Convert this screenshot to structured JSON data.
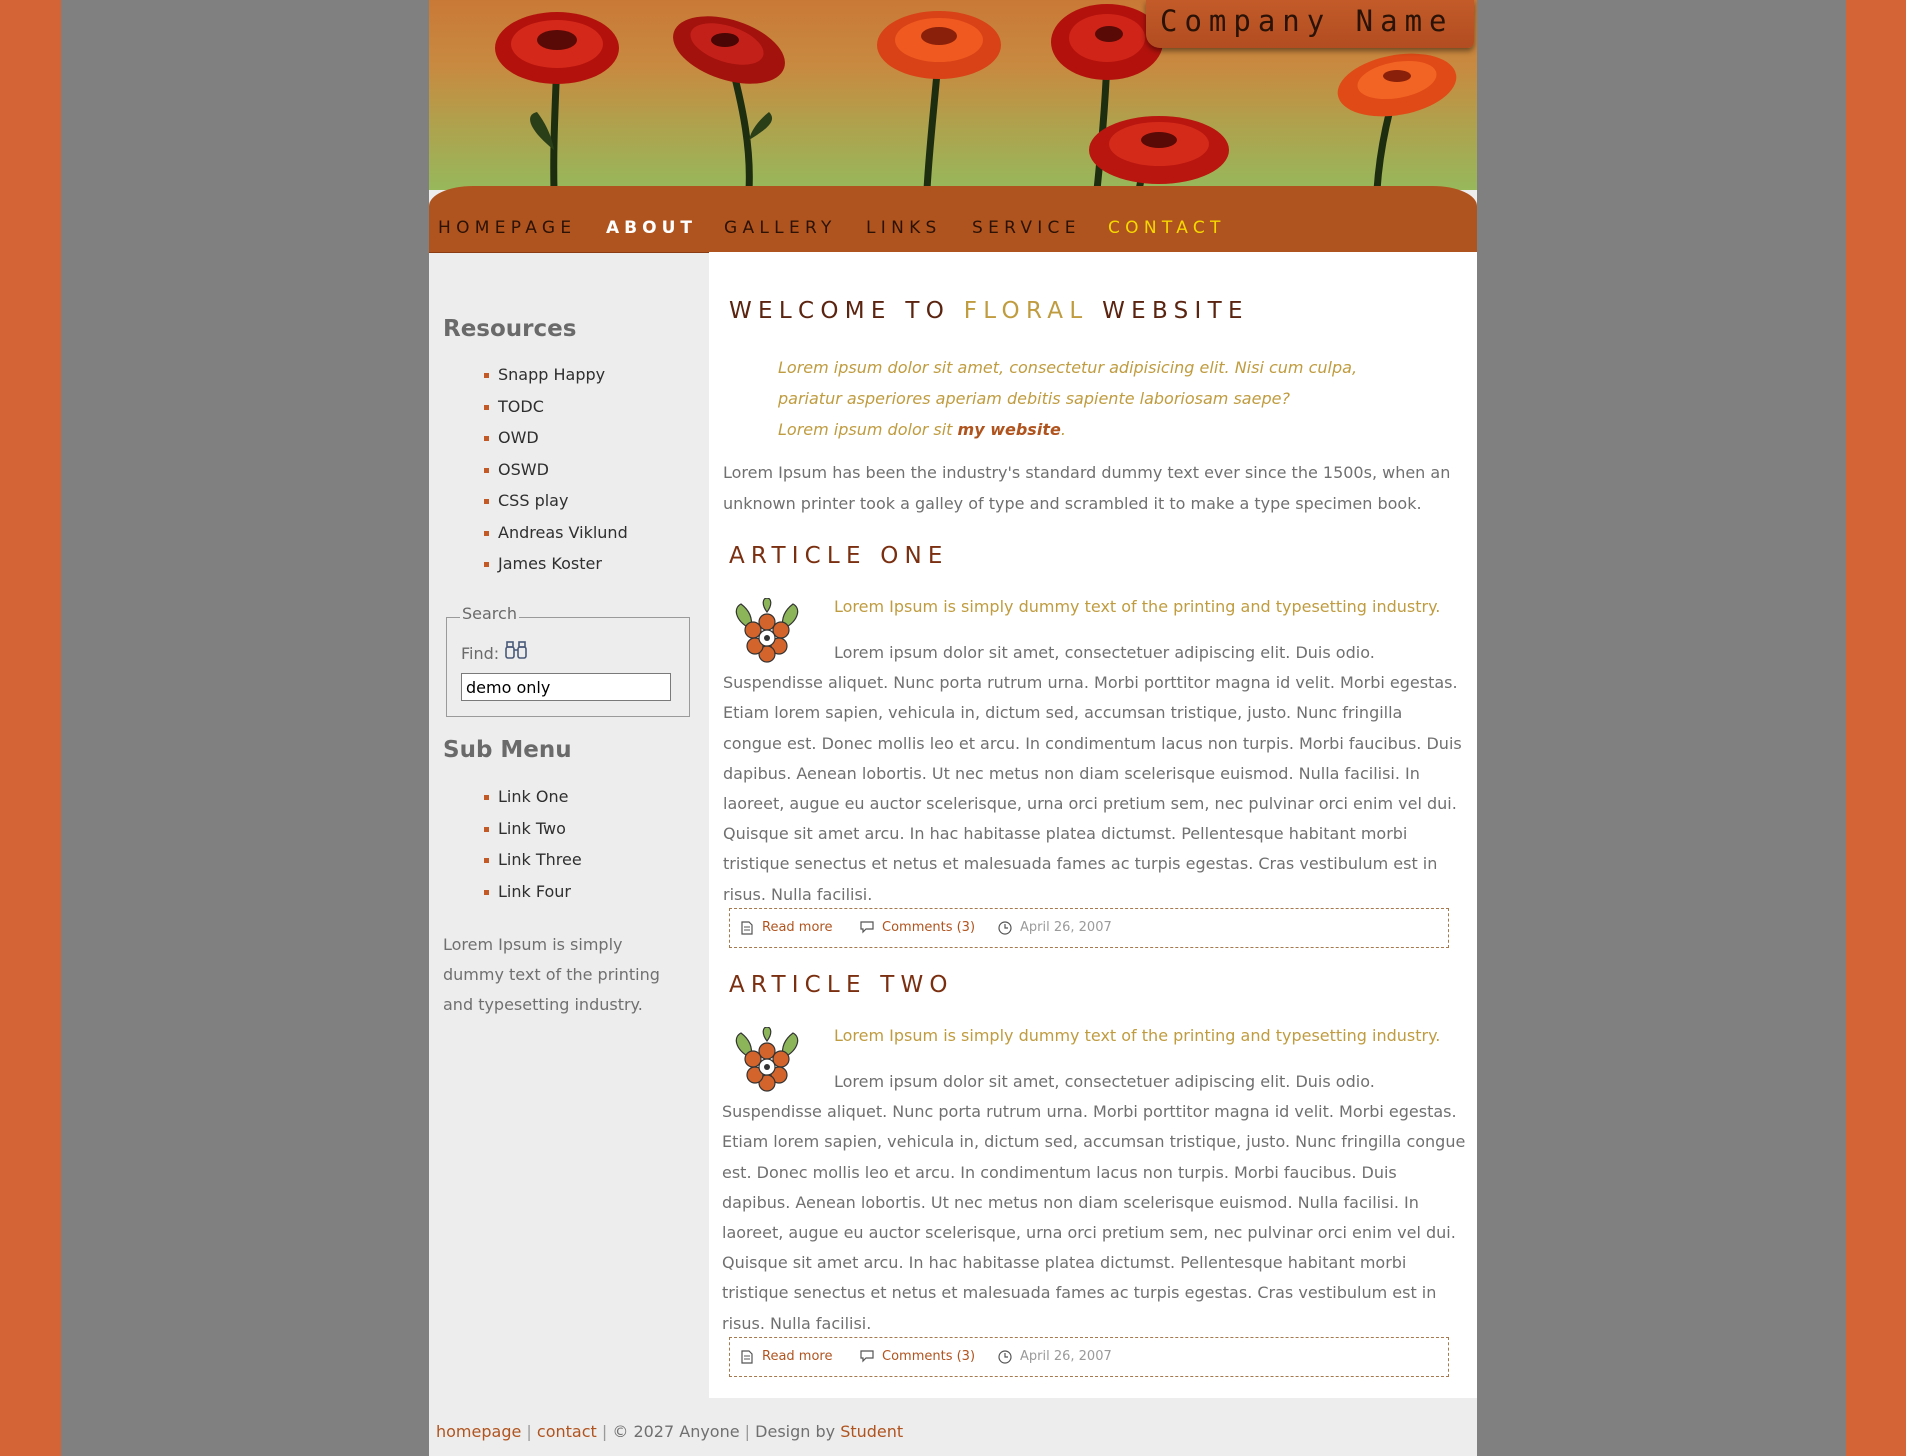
{
  "header": {
    "company_name": "Company Name"
  },
  "nav": [
    {
      "label": "HOMEPAGE"
    },
    {
      "label": "ABOUT"
    },
    {
      "label": "GALLERY"
    },
    {
      "label": "LINKS"
    },
    {
      "label": "SERVICE"
    },
    {
      "label": "CONTACT"
    }
  ],
  "sidebar": {
    "resources_title": "Resources",
    "resources": [
      "Snapp Happy",
      "TODC",
      "OWD",
      "OSWD",
      "CSS play",
      "Andreas Viklund",
      "James Koster"
    ],
    "search_legend": "Search",
    "find_label": "Find:",
    "search_value": "demo only",
    "submenu_title": "Sub Menu",
    "submenu": [
      "Link One",
      "Link Two",
      "Link Three",
      "Link Four"
    ],
    "note": "Lorem Ipsum is simply dummy text of the printing and typesetting industry."
  },
  "welcome": {
    "title_a": "WELCOME TO",
    "title_b": "FLORAL",
    "title_c": "WEBSITE",
    "quote_line1": "Lorem ipsum dolor sit amet, consectetur adipisicing elit. Nisi cum culpa,",
    "quote_line2": "pariatur asperiores aperiam debitis sapiente laboriosam saepe?",
    "quote_line3_text": "Lorem ipsum dolor sit",
    "quote_line3_link": "my website",
    "quote_line3_end": ".",
    "intro": "Lorem Ipsum has been the industry's standard dummy text ever since the 1500s, when an unknown printer took a galley of type and scrambled it to make a type specimen book."
  },
  "articles": [
    {
      "title": "ARTICLE ONE",
      "lead": "Lorem Ipsum is simply dummy text of the printing and typesetting industry.",
      "body": "Lorem ipsum dolor sit amet, consectetuer adipiscing elit. Duis odio. Suspendisse aliquet. Nunc porta rutrum urna. Morbi porttitor magna id velit. Morbi egestas. Etiam lorem sapien, vehicula in, dictum sed, accumsan tristique, justo. Nunc fringilla congue est. Donec mollis leo et arcu. In condimentum lacus non turpis. Morbi faucibus. Duis dapibus. Aenean lobortis. Ut nec metus non diam scelerisque euismod. Nulla facilisi. In laoreet, augue eu auctor scelerisque, urna orci pretium sem, nec pulvinar orci enim vel dui. Quisque sit amet arcu. In hac habitasse platea dictumst. Pellentesque habitant morbi tristique senectus et netus et malesuada fames ac turpis egestas. Cras vestibulum est in risus. Nulla facilisi.",
      "read_more": "Read more",
      "comments": "Comments (3)",
      "date": "April 26, 2007"
    },
    {
      "title": "ARTICLE TWO",
      "lead": "Lorem Ipsum is simply dummy text of the printing and typesetting industry.",
      "body": "Lorem ipsum dolor sit amet, consectetuer adipiscing elit. Duis odio. Suspendisse aliquet. Nunc porta rutrum urna. Morbi porttitor magna id velit. Morbi egestas. Etiam lorem sapien, vehicula in, dictum sed, accumsan tristique, justo. Nunc fringilla congue est. Donec mollis leo et arcu. In condimentum lacus non turpis. Morbi faucibus. Duis dapibus. Aenean lobortis. Ut nec metus non diam scelerisque euismod. Nulla facilisi. In laoreet, augue eu auctor scelerisque, urna orci pretium sem, nec pulvinar orci enim vel dui. Quisque sit amet arcu. In hac habitasse platea dictumst. Pellentesque habitant morbi tristique senectus et netus et malesuada fames ac turpis egestas. Cras vestibulum est in risus. Nulla facilisi.",
      "read_more": "Read more",
      "comments": "Comments (3)",
      "date": "April 26, 2007"
    }
  ],
  "footer": {
    "link_home": "homepage",
    "link_contact": "contact",
    "copyright": "© 2027 Anyone",
    "design_by": "Design by",
    "designer": "Student",
    "sep": "|"
  },
  "colors": {
    "side_band": "#d46436",
    "page_bg": "#808080",
    "nav_bg": "#b0541f",
    "accent_gold": "#c09c40",
    "accent_rust": "#b0541f",
    "heading": "#7a2f10",
    "active_nav_yellow": "#f5d800"
  },
  "icons": [
    "binoculars-icon",
    "flower-icon",
    "document-icon",
    "comment-icon",
    "clock-icon"
  ]
}
